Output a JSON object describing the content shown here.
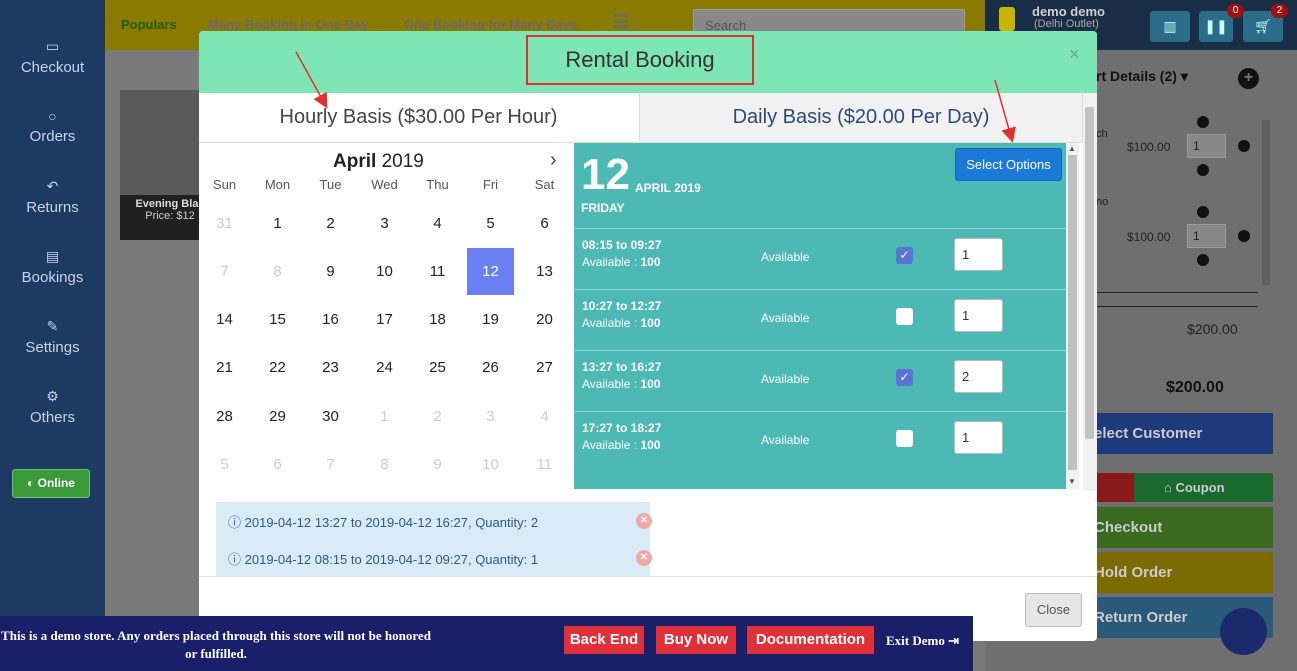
{
  "sidebar": {
    "items": [
      {
        "label": "Checkout",
        "icon": "credit-card-icon"
      },
      {
        "label": "Orders",
        "icon": "circle-icon"
      },
      {
        "label": "Returns",
        "icon": "reply-icon"
      },
      {
        "label": "Bookings",
        "icon": "book-icon"
      },
      {
        "label": "Settings",
        "icon": "wrench-icon"
      },
      {
        "label": "Others",
        "icon": "cogs-icon"
      }
    ],
    "online_label": "Online"
  },
  "topnav": {
    "links": [
      "Populars",
      "Many Booking in One Day",
      "One Booking for Many Days"
    ],
    "search_placeholder": "Search"
  },
  "product": {
    "name": "Evening Blac",
    "price": "Price: $12"
  },
  "header_right": {
    "user_name": "demo demo",
    "outlet": "(Delhi Outlet)",
    "badge_orders": "0",
    "badge_cart": "2"
  },
  "cart": {
    "title": "rt Details (2)",
    "item_fragment_1": "ch",
    "item_fragment_2": "no",
    "items": [
      {
        "price": "$100.00",
        "qty": "1"
      },
      {
        "price": "$100.00",
        "qty": "1"
      }
    ],
    "subtotal": "$200.00",
    "total": "$200.00",
    "buttons": [
      "elect Customer",
      "Coupon",
      "Checkout",
      "Hold Order",
      "Return Order"
    ]
  },
  "modal": {
    "title": "Rental Booking",
    "close_symbol": "×",
    "tabs": [
      {
        "label": "Hourly Basis ($30.00 Per Hour)"
      },
      {
        "label": "Daily Basis ($20.00 Per Day)"
      }
    ],
    "calendar": {
      "month": "April",
      "year": "2019",
      "weekdays": [
        "Sun",
        "Mon",
        "Tue",
        "Wed",
        "Thu",
        "Fri",
        "Sat"
      ],
      "weeks": [
        [
          "31",
          "1",
          "2",
          "3",
          "4",
          "5",
          "6"
        ],
        [
          "7",
          "8",
          "9",
          "10",
          "11",
          "12",
          "13"
        ],
        [
          "14",
          "15",
          "16",
          "17",
          "18",
          "19",
          "20"
        ],
        [
          "21",
          "22",
          "23",
          "24",
          "25",
          "26",
          "27"
        ],
        [
          "28",
          "29",
          "30",
          "1",
          "2",
          "3",
          "4"
        ],
        [
          "5",
          "6",
          "7",
          "8",
          "9",
          "10",
          "11"
        ]
      ],
      "selected": "12"
    },
    "slots_header": {
      "day": "12",
      "month_year": "APRIL 2019",
      "weekday": "FRIDAY",
      "select_button": "Select Options"
    },
    "slots": [
      {
        "time": "08:15 to 09:27",
        "available_label": "Available :",
        "available_count": "100",
        "status": "Available",
        "checked": true,
        "qty": "1"
      },
      {
        "time": "10:27 to 12:27",
        "available_label": "Available :",
        "available_count": "100",
        "status": "Available",
        "checked": false,
        "qty": "1"
      },
      {
        "time": "13:27 to 16:27",
        "available_label": "Available :",
        "available_count": "100",
        "status": "Available",
        "checked": true,
        "qty": "2"
      },
      {
        "time": "17:27 to 18:27",
        "available_label": "Available :",
        "available_count": "100",
        "status": "Available",
        "checked": false,
        "qty": "1"
      }
    ],
    "selections": [
      "2019-04-12 13:27 to 2019-04-12 16:27, Quantity: 2",
      "2019-04-12 08:15 to 2019-04-12 09:27, Quantity: 1"
    ],
    "close_button": "Close"
  },
  "demo_bar": {
    "notice": "This is a demo store. Any orders placed through this store will not be honored or fulfilled.",
    "buttons": [
      "Back End",
      "Buy Now",
      "Documentation"
    ],
    "exit_label": "Exit Demo"
  },
  "colors": {
    "header": "#7ee5b4",
    "slots_panel": "#4cb9b5",
    "selected_day": "#6b7ff5",
    "select_button": "#1b7ad8",
    "annotation": "#e23030",
    "demo_bar": "#1a1f6a"
  }
}
